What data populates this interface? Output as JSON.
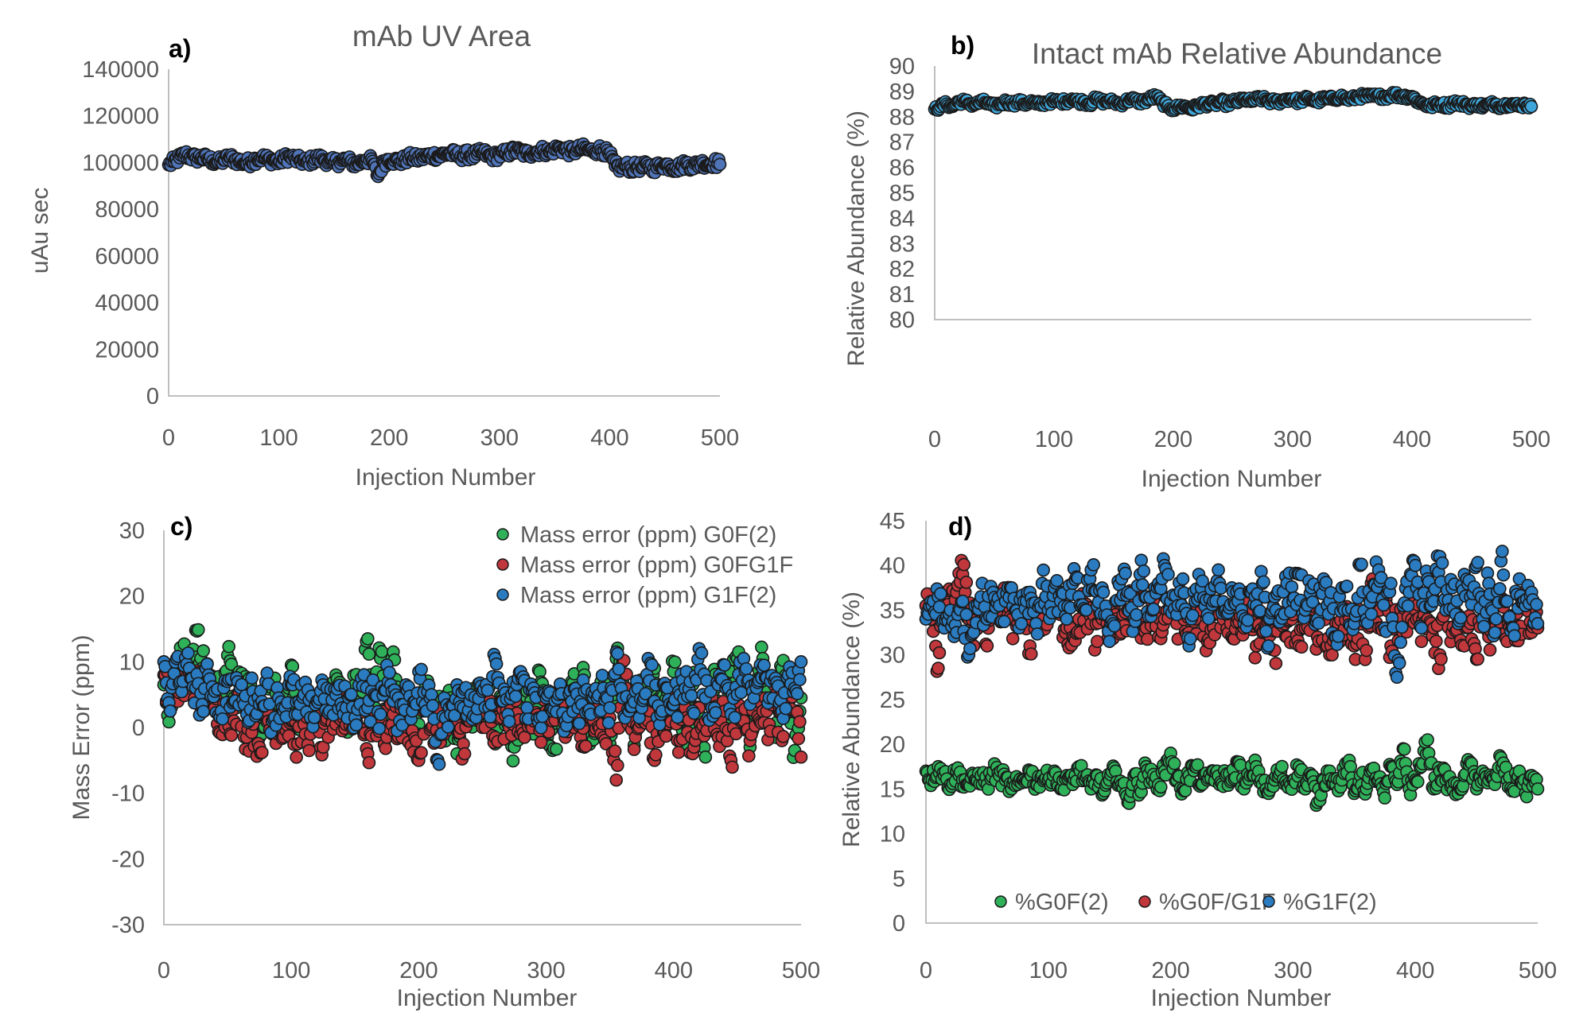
{
  "chart_data": [
    {
      "id": "a",
      "type": "scatter",
      "panel_label": "a)",
      "title": "mAb UV Area",
      "xlabel": "Injection Number",
      "ylabel": "uAu sec",
      "xlim": [
        0,
        500
      ],
      "ylim": [
        0,
        140000
      ],
      "xticks": [
        "0",
        "100",
        "200",
        "300",
        "400",
        "500"
      ],
      "yticks": [
        "0",
        "20000",
        "40000",
        "60000",
        "80000",
        "100000",
        "120000",
        "140000"
      ],
      "grid": false,
      "legend": null,
      "x_step": 5,
      "series": [
        {
          "name": "mAb UV Area",
          "color": "#4f74b8",
          "values": [
            99000,
            100500,
            102000,
            103500,
            102500,
            101800,
            102200,
            101500,
            100800,
            100200,
            101000,
            102300,
            101200,
            100500,
            99800,
            100400,
            101600,
            102100,
            101400,
            100900,
            100300,
            101800,
            102500,
            101300,
            100700,
            100200,
            101000,
            101900,
            101300,
            100600,
            99800,
            100500,
            101200,
            100400,
            99200,
            100300,
            101400,
            100500,
            94000,
            100200,
            101300,
            100800,
            100100,
            101500,
            102300,
            101600,
            102100,
            102800,
            103200,
            102600,
            103600,
            104100,
            103300,
            102700,
            103400,
            102900,
            103600,
            104200,
            103100,
            102500,
            103200,
            103800,
            104600,
            105100,
            104300,
            103700,
            104200,
            104800,
            105200,
            104500,
            105600,
            106200,
            105300,
            104600,
            105200,
            106000,
            105400,
            104700,
            105800,
            104900,
            103200,
            98500,
            97800,
            98600,
            97400,
            98300,
            97900,
            98700,
            97600,
            98400,
            99200,
            98300,
            97800,
            98600,
            99400,
            98500,
            99100,
            99800,
            99300,
            100100,
            99200
          ]
        }
      ]
    },
    {
      "id": "b",
      "type": "scatter",
      "panel_label": "b)",
      "title": "Intact mAb Relative Abundance",
      "xlabel": "Injection Number",
      "ylabel": "Relative Abundance (%)",
      "xlim": [
        0,
        500
      ],
      "ylim": [
        80,
        90
      ],
      "xticks": [
        "0",
        "100",
        "200",
        "300",
        "400",
        "500"
      ],
      "yticks": [
        "80",
        "81",
        "82",
        "83",
        "84",
        "85",
        "86",
        "87",
        "88",
        "89",
        "90"
      ],
      "grid": false,
      "legend": null,
      "x_step": 5,
      "series": [
        {
          "name": "Intact mAb Relative Abundance",
          "color": "#3fa6da",
          "values": [
            88.3,
            88.4,
            88.5,
            88.4,
            88.6,
            88.6,
            88.5,
            88.5,
            88.6,
            88.5,
            88.4,
            88.5,
            88.6,
            88.5,
            88.6,
            88.5,
            88.6,
            88.5,
            88.5,
            88.6,
            88.6,
            88.6,
            88.6,
            88.7,
            88.6,
            88.6,
            88.5,
            88.7,
            88.6,
            88.6,
            88.6,
            88.5,
            88.6,
            88.7,
            88.6,
            88.6,
            88.7,
            88.8,
            88.6,
            88.4,
            88.3,
            88.4,
            88.4,
            88.3,
            88.4,
            88.5,
            88.5,
            88.5,
            88.6,
            88.5,
            88.6,
            88.6,
            88.7,
            88.6,
            88.7,
            88.7,
            88.6,
            88.6,
            88.6,
            88.7,
            88.7,
            88.6,
            88.7,
            88.7,
            88.6,
            88.7,
            88.7,
            88.7,
            88.8,
            88.7,
            88.7,
            88.8,
            88.8,
            88.8,
            88.8,
            88.8,
            88.8,
            88.9,
            88.8,
            88.8,
            88.8,
            88.6,
            88.5,
            88.4,
            88.5,
            88.5,
            88.4,
            88.6,
            88.5,
            88.5,
            88.4,
            88.5,
            88.4,
            88.5,
            88.5,
            88.4,
            88.5,
            88.5,
            88.4,
            88.5,
            88.4
          ]
        }
      ]
    },
    {
      "id": "c",
      "type": "scatter",
      "panel_label": "c)",
      "title": "",
      "xlabel": "Injection Number",
      "ylabel": "Mass Error (ppm)",
      "xlim": [
        0,
        500
      ],
      "ylim": [
        -30,
        30
      ],
      "xticks": [
        "0",
        "100",
        "200",
        "300",
        "400",
        "500"
      ],
      "yticks": [
        "-30",
        "-20",
        "-10",
        "0",
        "10",
        "20",
        "30"
      ],
      "grid": false,
      "legend": "top-right",
      "x_step": 5,
      "series": [
        {
          "name": "Mass error (ppm) G0F(2)",
          "color": "#2fb15a",
          "values": [
            6.5,
            3.0,
            9.5,
            10.5,
            8.0,
            14.8,
            9.0,
            8.0,
            6.5,
            5.0,
            11.0,
            4.5,
            6.0,
            7.0,
            4.5,
            -1.5,
            3.0,
            6.0,
            3.5,
            2.0,
            9.5,
            1.0,
            4.0,
            2.5,
            1.5,
            3.0,
            1.0,
            8.0,
            5.0,
            0.5,
            6.5,
            2.5,
            13.5,
            4.5,
            10.5,
            2.0,
            11.5,
            3.0,
            1.5,
            4.0,
            0.5,
            6.0,
            2.5,
            3.5,
            0.0,
            4.5,
            -4.0,
            2.0,
            1.0,
            5.0,
            2.5,
            6.0,
            -2.5,
            4.5,
            1.5,
            -3.0,
            3.5,
            5.5,
            -1.0,
            8.5,
            2.0,
            -3.5,
            1.5,
            4.0,
            7.0,
            3.0,
            8.0,
            -2.0,
            2.5,
            5.5,
            -2.5,
            10.5,
            7.0,
            4.0,
            -1.0,
            6.5,
            2.0,
            9.0,
            1.5,
            5.5,
            8.5,
            3.0,
            -2.5,
            6.5,
            2.0,
            -4.5,
            7.5,
            4.0,
            0.5,
            8.5,
            10.5,
            3.0,
            -3.0,
            6.5,
            10.5,
            4.5,
            -1.5,
            9.0,
            6.0,
            -3.5,
            4.5
          ]
        },
        {
          "name": "Mass error (ppm) G0FG1F",
          "color": "#c0373c",
          "values": [
            8.0,
            4.5,
            6.0,
            5.5,
            8.0,
            7.0,
            4.0,
            5.5,
            3.0,
            1.5,
            2.5,
            1.0,
            4.0,
            -1.5,
            0.5,
            -3.0,
            2.0,
            -1.0,
            1.5,
            0.0,
            1.0,
            -2.5,
            0.5,
            -1.0,
            1.5,
            -3.0,
            2.0,
            0.5,
            -0.5,
            3.0,
            1.0,
            2.5,
            -4.0,
            1.5,
            0.5,
            -1.5,
            2.0,
            0.0,
            1.0,
            -0.5,
            -5.0,
            2.5,
            0.0,
            1.5,
            -1.0,
            2.0,
            0.5,
            -2.5,
            1.0,
            2.5,
            0.0,
            3.0,
            -1.5,
            1.5,
            0.5,
            2.0,
            -1.0,
            3.0,
            1.0,
            -0.5,
            2.5,
            1.0,
            3.5,
            -1.5,
            2.0,
            0.5,
            -3.0,
            1.5,
            3.0,
            -1.5,
            1.5,
            -8.0,
            10.0,
            2.0,
            -1.5,
            3.5,
            1.0,
            -5.0,
            2.5,
            0.5,
            4.0,
            -2.0,
            1.5,
            -4.0,
            3.0,
            1.0,
            4.5,
            -1.5,
            2.5,
            -5.0,
            3.5,
            1.0,
            -2.0,
            4.0,
            2.5,
            0.5,
            5.0,
            -2.0,
            3.5,
            7.5,
            -4.5
          ]
        },
        {
          "name": "Mass error (ppm) G1F(2)",
          "color": "#2a7bc0",
          "values": [
            10.0,
            2.5,
            10.5,
            7.0,
            9.0,
            6.0,
            3.5,
            8.0,
            5.5,
            2.5,
            7.0,
            4.0,
            6.0,
            2.0,
            5.5,
            3.5,
            7.0,
            1.0,
            4.5,
            3.0,
            6.5,
            2.0,
            5.0,
            1.5,
            4.0,
            6.5,
            2.5,
            5.0,
            3.0,
            4.5,
            1.5,
            7.5,
            3.0,
            5.0,
            2.0,
            9.5,
            4.0,
            1.0,
            6.5,
            2.5,
            8.5,
            3.5,
            5.0,
            -5.0,
            4.5,
            2.0,
            6.5,
            3.0,
            4.0,
            1.5,
            5.5,
            3.0,
            10.5,
            4.0,
            2.0,
            5.5,
            8.5,
            3.0,
            6.0,
            1.5,
            4.5,
            2.5,
            5.0,
            1.0,
            4.0,
            3.0,
            5.5,
            2.0,
            4.5,
            6.0,
            3.0,
            11.5,
            4.5,
            2.5,
            5.5,
            3.0,
            10.5,
            4.0,
            2.0,
            6.0,
            3.5,
            5.0,
            8.5,
            2.5,
            12.0,
            4.5,
            3.0,
            6.5,
            9.5,
            2.0,
            5.0,
            10.5,
            3.5,
            6.0,
            9.0,
            4.5,
            7.5,
            2.5,
            8.0,
            6.0,
            10.0
          ]
        }
      ]
    },
    {
      "id": "d",
      "type": "scatter",
      "panel_label": "d)",
      "title": "",
      "xlabel": "Injection Number",
      "ylabel": "Relative Abundance (%)",
      "xlim": [
        0,
        500
      ],
      "ylim": [
        0,
        45
      ],
      "xticks": [
        "0",
        "100",
        "200",
        "300",
        "400",
        "500"
      ],
      "yticks": [
        "0",
        "5",
        "10",
        "15",
        "20",
        "25",
        "30",
        "35",
        "40",
        "45"
      ],
      "grid": false,
      "legend": "bottom-center",
      "x_step": 5,
      "series": [
        {
          "name": "%G0F(2)",
          "color": "#2fb15a",
          "values": [
            17.0,
            16.0,
            17.5,
            16.5,
            15.5,
            17.0,
            16.0,
            15.5,
            16.0,
            16.5,
            15.5,
            17.0,
            16.5,
            16.0,
            15.0,
            15.5,
            16.0,
            17.0,
            15.5,
            16.5,
            16.0,
            17.0,
            15.0,
            16.5,
            15.5,
            17.5,
            16.0,
            15.0,
            16.5,
            14.5,
            16.0,
            17.0,
            15.5,
            13.5,
            16.5,
            15.0,
            17.5,
            16.0,
            15.5,
            17.0,
            19.0,
            16.0,
            15.0,
            16.5,
            17.5,
            15.5,
            16.0,
            17.0,
            15.5,
            16.5,
            16.0,
            18.0,
            15.0,
            16.5,
            17.5,
            15.5,
            14.5,
            16.0,
            17.0,
            15.5,
            16.0,
            17.5,
            15.0,
            16.5,
            13.5,
            16.0,
            17.0,
            15.5,
            16.0,
            18.0,
            14.5,
            16.5,
            15.0,
            17.0,
            16.0,
            14.0,
            17.5,
            15.5,
            19.5,
            15.0,
            16.0,
            17.5,
            20.5,
            15.0,
            17.0,
            16.0,
            15.5,
            14.5,
            16.5,
            18.0,
            15.0,
            17.0,
            16.0,
            15.5,
            18.5,
            16.0,
            15.0,
            17.0,
            14.5,
            16.5,
            15.0
          ]
        },
        {
          "name": "%G0F/G1F",
          "color": "#c0373c",
          "values": [
            35.5,
            35.0,
            28.5,
            36.5,
            35.0,
            37.0,
            39.0,
            34.0,
            33.0,
            35.5,
            31.0,
            34.5,
            35.0,
            36.0,
            34.0,
            33.5,
            35.0,
            31.0,
            35.5,
            34.0,
            35.0,
            36.0,
            34.5,
            33.0,
            32.0,
            34.0,
            35.5,
            33.5,
            31.5,
            35.0,
            33.0,
            34.5,
            32.5,
            35.0,
            36.5,
            34.0,
            33.0,
            35.5,
            32.0,
            34.0,
            36.0,
            33.5,
            35.0,
            32.5,
            34.0,
            35.0,
            31.5,
            33.0,
            34.5,
            35.5,
            32.0,
            34.0,
            33.0,
            35.0,
            31.0,
            32.5,
            34.0,
            30.5,
            33.5,
            32.0,
            34.5,
            31.0,
            33.0,
            35.0,
            32.0,
            34.0,
            30.0,
            33.5,
            32.5,
            35.0,
            31.0,
            34.0,
            30.5,
            38.5,
            33.0,
            35.5,
            31.0,
            34.0,
            32.5,
            36.0,
            35.0,
            31.5,
            34.0,
            33.0,
            30.0,
            36.0,
            32.5,
            34.5,
            31.0,
            33.5,
            29.5,
            35.0,
            32.0,
            34.0,
            35.5,
            31.5,
            34.0,
            33.0,
            35.5,
            32.5,
            33.0
          ]
        },
        {
          "name": "%G1F(2)",
          "color": "#2a7bc0",
          "values": [
            34.0,
            35.5,
            36.5,
            33.0,
            35.0,
            32.5,
            36.0,
            30.0,
            35.5,
            36.5,
            34.0,
            37.0,
            35.5,
            36.0,
            37.5,
            34.5,
            36.0,
            37.0,
            33.5,
            38.0,
            35.0,
            37.5,
            36.0,
            34.0,
            38.0,
            36.5,
            35.0,
            39.5,
            35.5,
            37.0,
            31.5,
            36.0,
            38.5,
            37.0,
            34.0,
            39.0,
            36.5,
            35.0,
            38.0,
            40.0,
            36.0,
            34.5,
            38.5,
            31.0,
            36.0,
            37.5,
            34.5,
            36.0,
            38.0,
            35.0,
            37.5,
            36.0,
            33.5,
            37.0,
            35.5,
            38.0,
            31.0,
            36.5,
            34.5,
            38.0,
            36.0,
            39.0,
            35.0,
            37.5,
            34.0,
            38.5,
            36.0,
            32.0,
            37.5,
            35.0,
            33.5,
            40.0,
            34.0,
            36.5,
            39.5,
            33.0,
            38.0,
            27.5,
            35.5,
            37.0,
            40.0,
            33.0,
            38.5,
            36.0,
            41.0,
            35.0,
            37.5,
            33.5,
            39.0,
            36.5,
            40.0,
            34.0,
            38.0,
            32.5,
            40.5,
            36.0,
            33.0,
            38.5,
            35.5,
            37.0,
            33.5
          ]
        }
      ]
    }
  ]
}
